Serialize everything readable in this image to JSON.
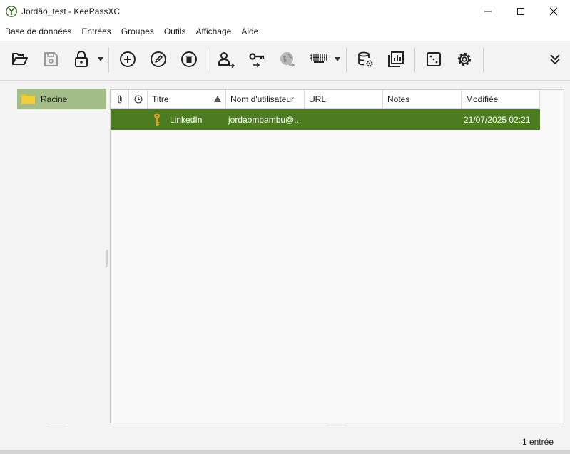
{
  "window": {
    "title": "Jordão_test - KeePassXC",
    "app_icon": "keepassxc-logo-icon",
    "controls": [
      "minimize-icon",
      "maximize-icon",
      "close-icon"
    ]
  },
  "menu": {
    "items": [
      "Base de données",
      "Entrées",
      "Groupes",
      "Outils",
      "Affichage",
      "Aide"
    ]
  },
  "toolbar": {
    "buttons": [
      {
        "name": "open-database",
        "icon": "folder-open-icon"
      },
      {
        "name": "save-database",
        "icon": "floppy-disk-icon",
        "disabled": true
      },
      {
        "name": "lock-database",
        "icon": "padlock-icon",
        "has_dropdown": true
      },
      {
        "name": "add-entry",
        "icon": "plus-circle-icon"
      },
      {
        "name": "edit-entry",
        "icon": "pencil-circle-icon"
      },
      {
        "name": "delete-entry",
        "icon": "trash-circle-icon"
      },
      {
        "name": "copy-username",
        "icon": "user-arrow-icon"
      },
      {
        "name": "copy-password",
        "icon": "key-arrow-icon"
      },
      {
        "name": "copy-url",
        "icon": "globe-arrow-icon",
        "disabled": true
      },
      {
        "name": "autotype",
        "icon": "keyboard-icon",
        "has_dropdown": true
      },
      {
        "name": "database-settings",
        "icon": "database-gear-icon"
      },
      {
        "name": "database-reports",
        "icon": "reports-icon"
      },
      {
        "name": "password-generator",
        "icon": "dice-icon"
      },
      {
        "name": "settings",
        "icon": "gear-icon"
      },
      {
        "name": "more-tools",
        "icon": "double-chevron-down-icon"
      }
    ]
  },
  "groups": {
    "items": [
      {
        "label": "Racine",
        "icon": "folder-icon",
        "selected": true
      }
    ]
  },
  "entries": {
    "columns": [
      {
        "key": "attachment",
        "label": "",
        "icon": "paperclip-icon"
      },
      {
        "key": "expires",
        "label": "",
        "icon": "clock-icon"
      },
      {
        "key": "title",
        "label": "Titre",
        "sorted": "ascending"
      },
      {
        "key": "username",
        "label": "Nom d'utilisateur"
      },
      {
        "key": "url",
        "label": "URL"
      },
      {
        "key": "notes",
        "label": "Notes"
      },
      {
        "key": "modified",
        "label": "Modifiée"
      }
    ],
    "rows": [
      {
        "icon": "key-icon",
        "title": "LinkedIn",
        "username": "jordaombambu@...",
        "url": "",
        "notes": "",
        "modified": "21/07/2025 02:21",
        "selected": true
      }
    ]
  },
  "status": {
    "text": "1 entrée"
  },
  "colors": {
    "selected_row": "#4b7c1f",
    "selected_group": "#a2bd86",
    "folder": "#e8c12a",
    "key_icon": "#d9a223"
  }
}
